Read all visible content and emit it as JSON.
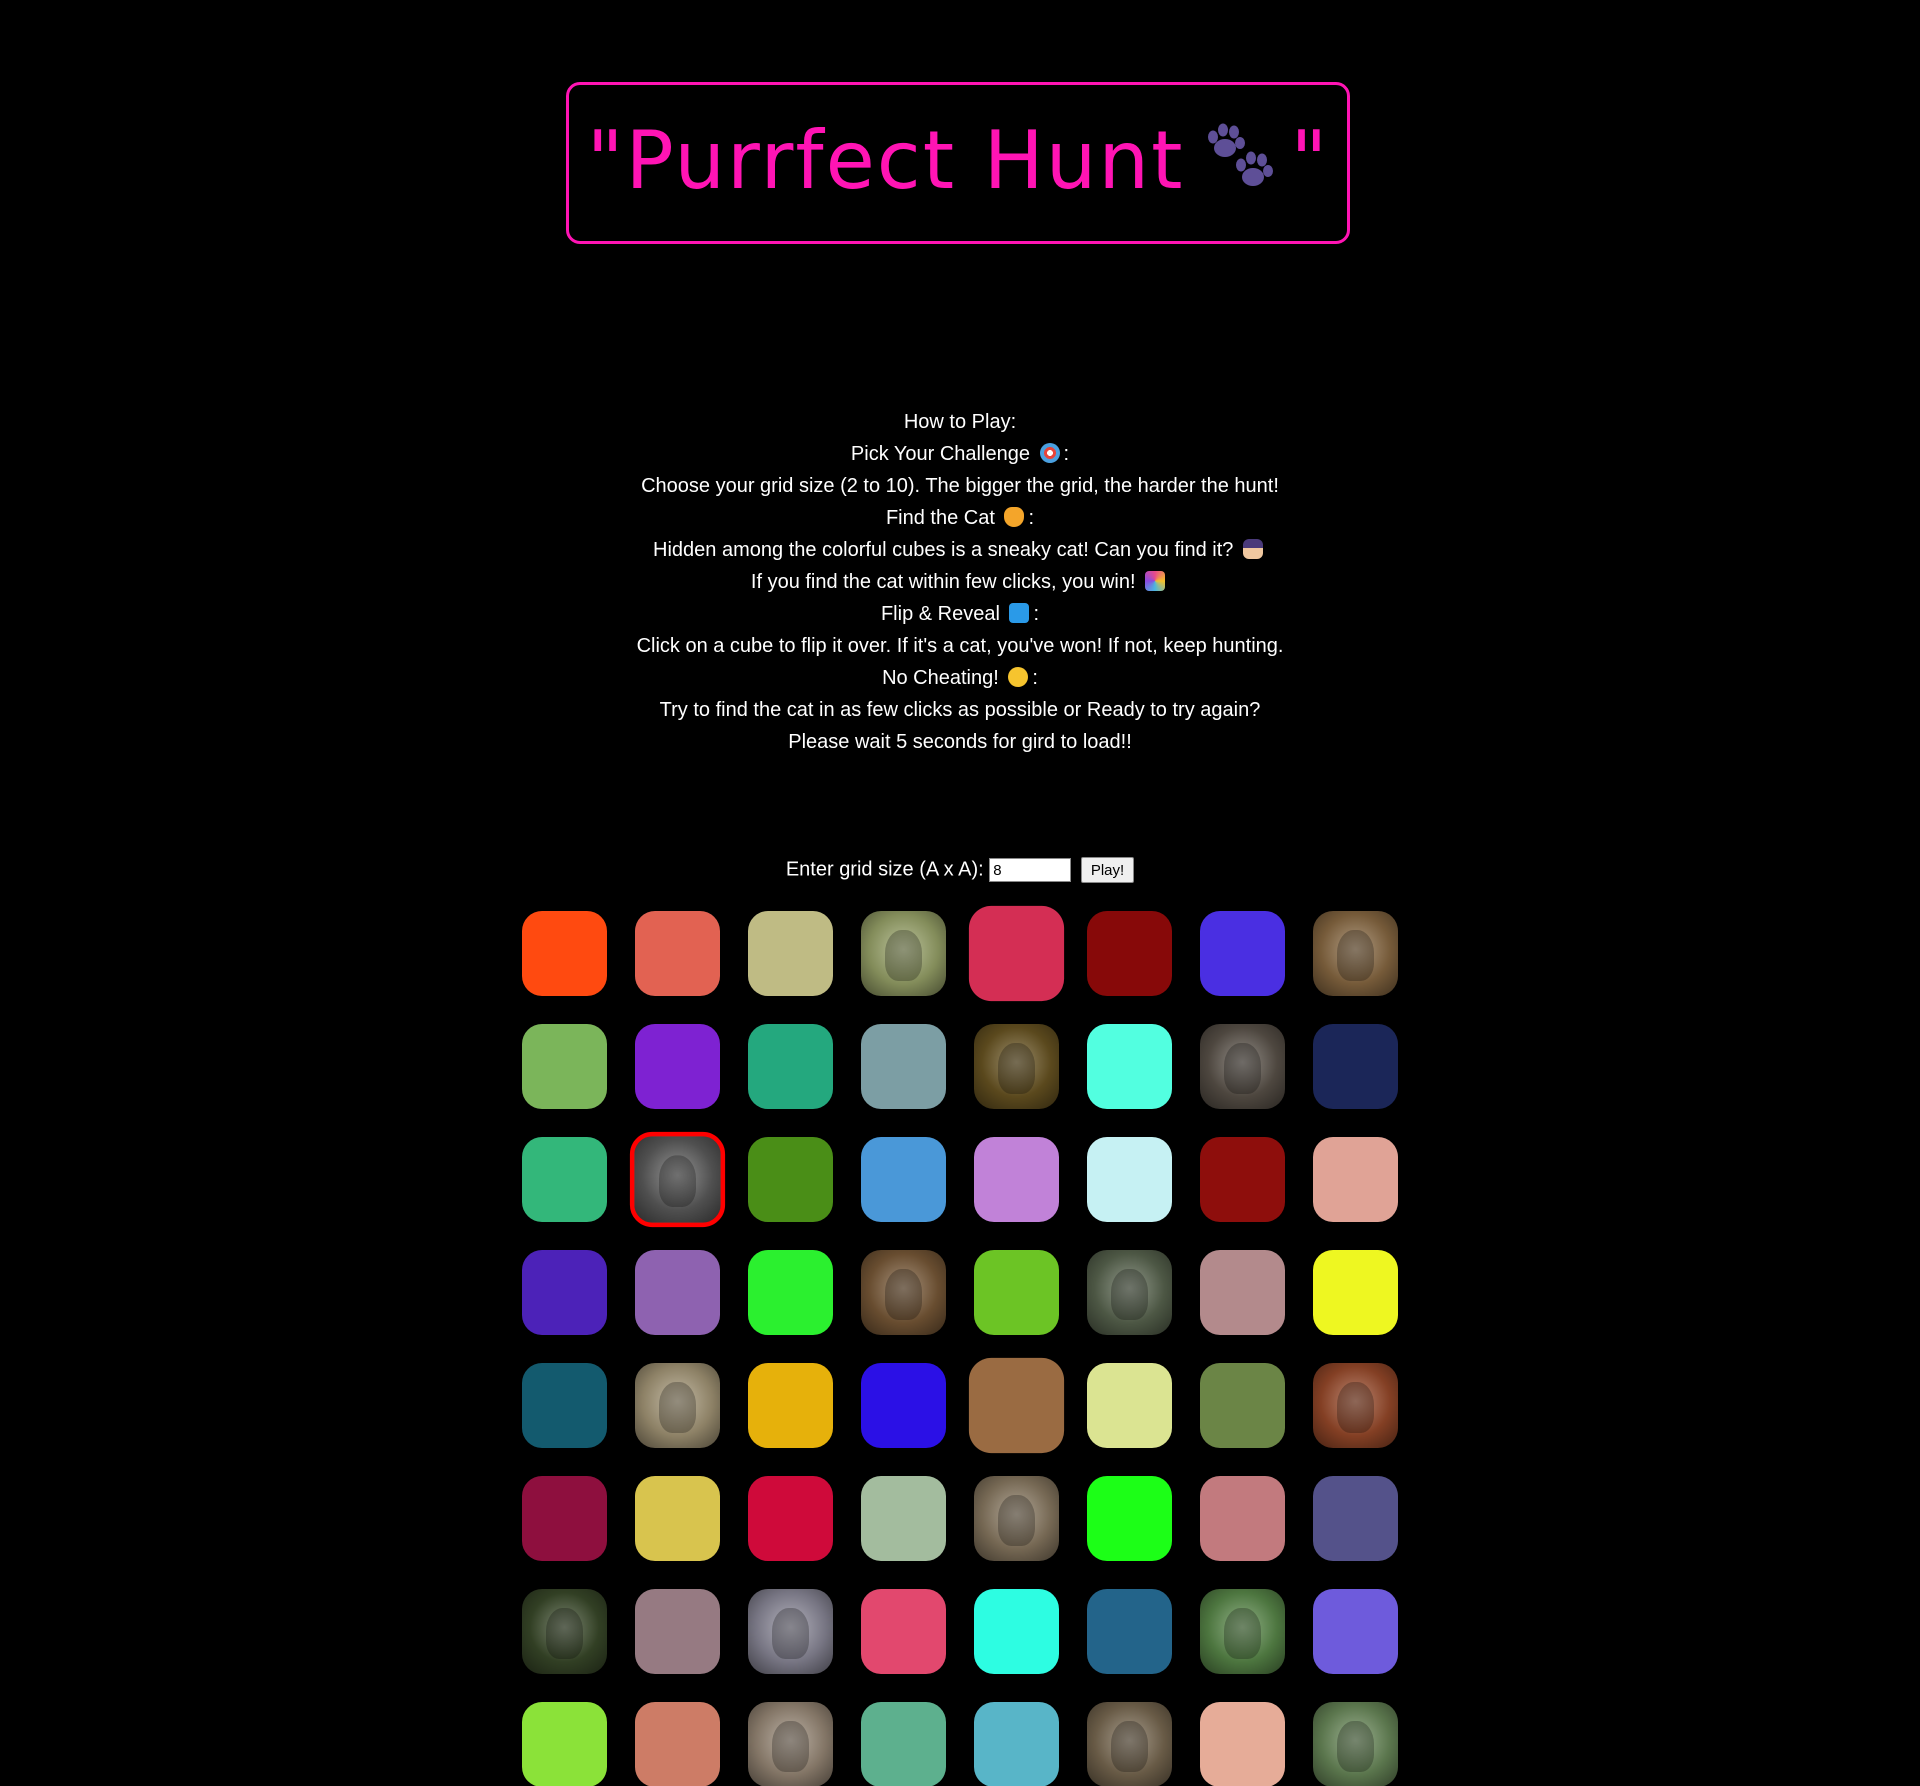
{
  "header": {
    "title_prefix": "\"Purrfect Hunt",
    "title_suffix": "\"",
    "title_icon": "paw-prints-icon",
    "border_color": "#ff14b4"
  },
  "instructions": {
    "heading": "How to Play:",
    "challenge_title": "Pick Your Challenge",
    "challenge_icon": "target-icon",
    "challenge_text": "Choose your grid size (2 to 10). The bigger the grid, the harder the hunt!",
    "find_title": "Find the Cat",
    "find_icon": "cat-face-icon",
    "find_text": "Hidden among the colorful cubes is a sneaky cat! Can you find it?",
    "find_text_icon": "detective-icon",
    "win_text": "If you find the cat within few clicks, you win!",
    "win_icon": "party-popper-icon",
    "flip_title": "Flip & Reveal",
    "flip_icon": "repeat-icon",
    "flip_text": "Click on a cube to flip it over. If it's a cat, you've won! If not, keep hunting.",
    "cheat_title": "No Cheating!",
    "cheat_icon": "shushing-face-icon",
    "cheat_text": "Try to find the cat in as few clicks as possible or Ready to try again?",
    "wait_text": "Please wait 5 seconds for gird to load!!",
    "colon": ":"
  },
  "controls": {
    "label": "Enter grid size (A x A):",
    "grid_size_value": "8",
    "play_label": "Play!"
  },
  "grid": {
    "size": 8,
    "cubes": [
      {
        "type": "color",
        "color": "#ff4a10"
      },
      {
        "type": "color",
        "color": "#e26252"
      },
      {
        "type": "color",
        "color": "#bfbb84"
      },
      {
        "type": "photo",
        "name": "dog-photo",
        "color": "#9aa56a"
      },
      {
        "type": "color",
        "color": "#d42e54",
        "big": true
      },
      {
        "type": "color",
        "color": "#870909"
      },
      {
        "type": "color",
        "color": "#4a2fe2"
      },
      {
        "type": "photo",
        "name": "dog-photo",
        "color": "#8a6a43"
      },
      {
        "type": "color",
        "color": "#7bb55a"
      },
      {
        "type": "color",
        "color": "#7e22d2"
      },
      {
        "type": "color",
        "color": "#24a87e"
      },
      {
        "type": "color",
        "color": "#7c9ea4"
      },
      {
        "type": "photo",
        "name": "dog-photo",
        "color": "#6a5522"
      },
      {
        "type": "color",
        "color": "#52ffe0"
      },
      {
        "type": "photo",
        "name": "dog-photo",
        "color": "#5b534a"
      },
      {
        "type": "color",
        "color": "#1b2658"
      },
      {
        "type": "color",
        "color": "#33b77a"
      },
      {
        "type": "photo",
        "name": "cat-photo",
        "color": "#5d5d5d",
        "selected": true
      },
      {
        "type": "color",
        "color": "#4a8e17"
      },
      {
        "type": "color",
        "color": "#4a98d8"
      },
      {
        "type": "color",
        "color": "#c182d8"
      },
      {
        "type": "color",
        "color": "#c6f1f3"
      },
      {
        "type": "color",
        "color": "#8e0e0c"
      },
      {
        "type": "color",
        "color": "#e0a396"
      },
      {
        "type": "color",
        "color": "#4c22b8"
      },
      {
        "type": "color",
        "color": "#8e62b0"
      },
      {
        "type": "color",
        "color": "#2bf02f"
      },
      {
        "type": "photo",
        "name": "dog-photo",
        "color": "#7a5a38"
      },
      {
        "type": "color",
        "color": "#6cc425"
      },
      {
        "type": "photo",
        "name": "dog-photo",
        "color": "#5a6650"
      },
      {
        "type": "color",
        "color": "#b38a8c"
      },
      {
        "type": "color",
        "color": "#eef721"
      },
      {
        "type": "color",
        "color": "#135a6e"
      },
      {
        "type": "photo",
        "name": "dog-photo",
        "color": "#a69878"
      },
      {
        "type": "color",
        "color": "#e6b10b"
      },
      {
        "type": "color",
        "color": "#2b10e6"
      },
      {
        "type": "color",
        "color": "#9a6b42",
        "big": true
      },
      {
        "type": "color",
        "color": "#dbe492"
      },
      {
        "type": "color",
        "color": "#6b8546"
      },
      {
        "type": "photo",
        "name": "dog-photo",
        "color": "#9a4a2a"
      },
      {
        "type": "color",
        "color": "#8e0f3e"
      },
      {
        "type": "color",
        "color": "#d8c44e"
      },
      {
        "type": "color",
        "color": "#cf0a3a"
      },
      {
        "type": "color",
        "color": "#a3bc9e"
      },
      {
        "type": "photo",
        "name": "dog-photo",
        "color": "#8a7a62"
      },
      {
        "type": "color",
        "color": "#1cff17"
      },
      {
        "type": "color",
        "color": "#c27a7e"
      },
      {
        "type": "color",
        "color": "#54528a"
      },
      {
        "type": "photo",
        "name": "dog-photo",
        "color": "#3a4a2a"
      },
      {
        "type": "color",
        "color": "#967a82"
      },
      {
        "type": "photo",
        "name": "dog-photo",
        "color": "#8c8a9a"
      },
      {
        "type": "color",
        "color": "#e2486e"
      },
      {
        "type": "color",
        "color": "#2dfde2"
      },
      {
        "type": "color",
        "color": "#23648a"
      },
      {
        "type": "photo",
        "name": "dog-photo",
        "color": "#5a8a4a"
      },
      {
        "type": "color",
        "color": "#6e5bdc"
      },
      {
        "type": "color",
        "color": "#8be239"
      },
      {
        "type": "color",
        "color": "#cd7c66"
      },
      {
        "type": "photo",
        "name": "dog-photo",
        "color": "#9a8a78"
      },
      {
        "type": "color",
        "color": "#5db08e"
      },
      {
        "type": "color",
        "color": "#58b5c8"
      },
      {
        "type": "photo",
        "name": "dog-photo",
        "color": "#7a6a52"
      },
      {
        "type": "color",
        "color": "#e6ac98"
      },
      {
        "type": "photo",
        "name": "dog-photo",
        "color": "#6a8a5a"
      }
    ]
  }
}
